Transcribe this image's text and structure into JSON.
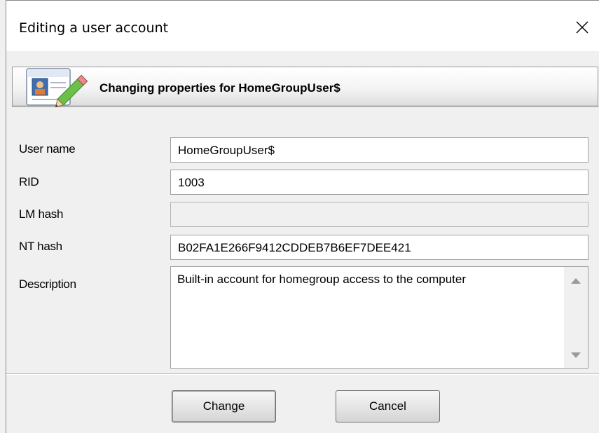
{
  "window": {
    "title": "Editing a user account"
  },
  "header": {
    "text": "Changing properties for HomeGroupUser$",
    "icon": "user-card-edit-icon"
  },
  "fields": [
    {
      "label": "User name",
      "value": "HomeGroupUser$"
    },
    {
      "label": "RID",
      "value": "1003"
    },
    {
      "label": "LM hash",
      "value": ""
    },
    {
      "label": "NT hash",
      "value": "B02FA1E266F9412CDDEB7B6EF7DEE421"
    }
  ],
  "description": {
    "label": "Description",
    "value": "Built-in account for homegroup access to the computer"
  },
  "buttons": {
    "change": "Change",
    "cancel": "Cancel"
  }
}
